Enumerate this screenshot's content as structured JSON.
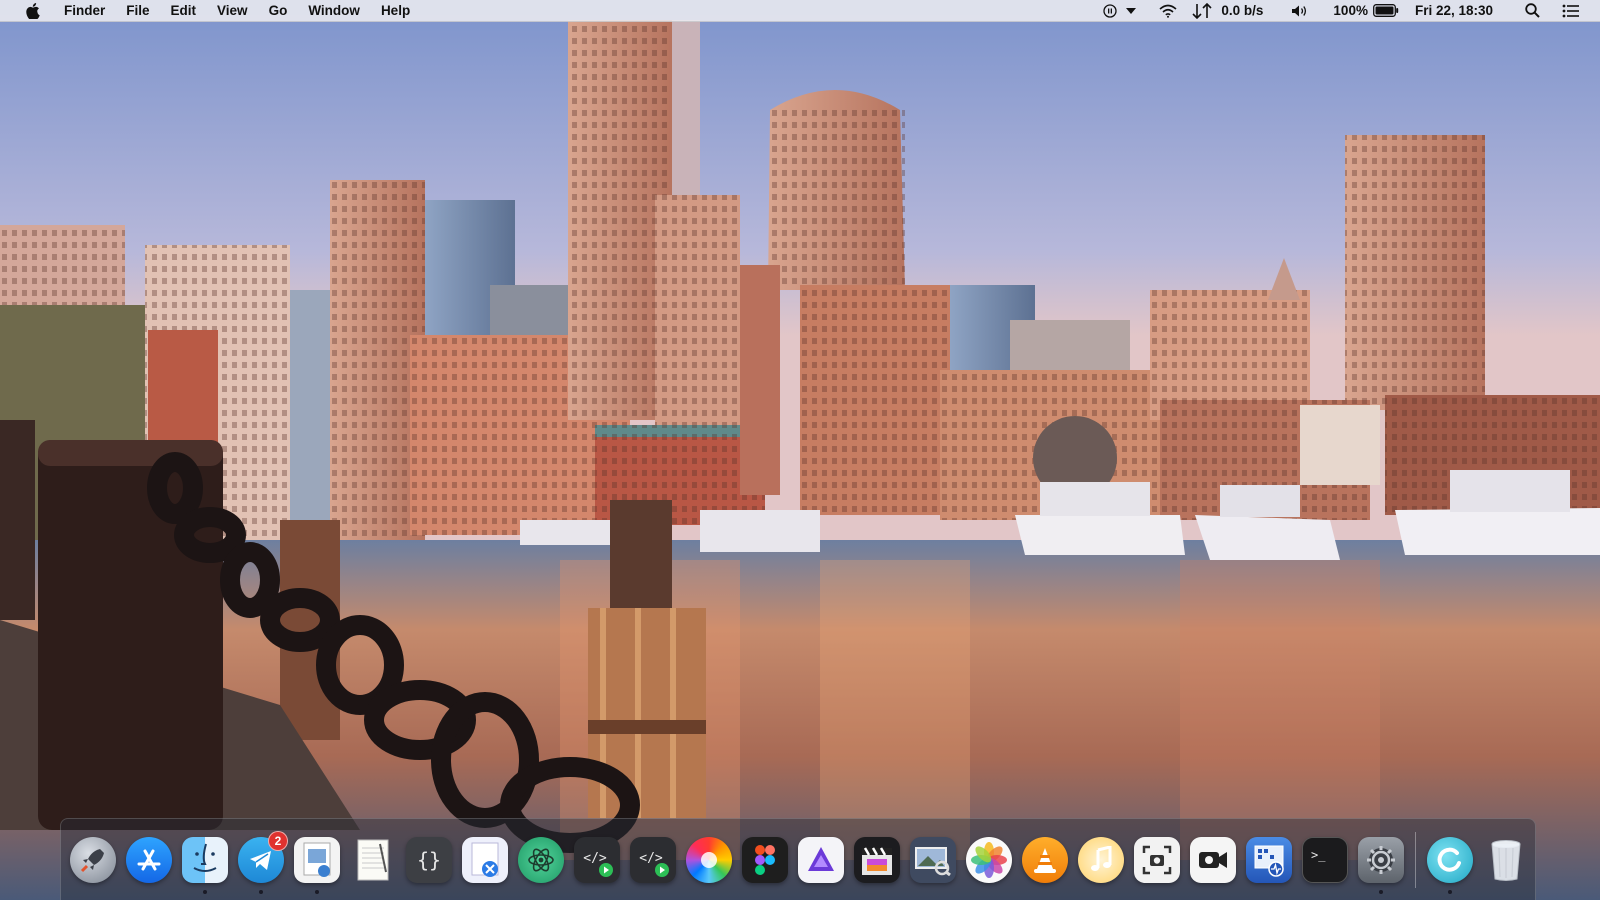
{
  "menubar": {
    "app_name": "Finder",
    "menus": [
      {
        "label": "File"
      },
      {
        "label": "Edit"
      },
      {
        "label": "View"
      },
      {
        "label": "Go"
      },
      {
        "label": "Window"
      },
      {
        "label": "Help"
      }
    ],
    "network_speed": "0.0 b/s",
    "battery_percent": "100%",
    "clock": "Fri 22, 18:30",
    "icons": [
      "apple-icon",
      "media-pause-icon",
      "dropdown-triangle-icon",
      "wifi-icon",
      "network-arrows-icon",
      "volume-icon",
      "battery-icon",
      "spotlight-search-icon",
      "notification-center-icon"
    ]
  },
  "dock": {
    "telegram_badge": "2",
    "apps": [
      {
        "name": "Launchpad",
        "icon": "rocket-icon"
      },
      {
        "name": "App Store",
        "icon": "app-store-icon"
      },
      {
        "name": "Finder",
        "icon": "finder-icon"
      },
      {
        "name": "Telegram",
        "icon": "telegram-icon"
      },
      {
        "name": "Preview",
        "icon": "preview-icon"
      },
      {
        "name": "TextEdit",
        "icon": "textedit-icon"
      },
      {
        "name": "Script Editor",
        "icon": "braces-icon"
      },
      {
        "name": "Xcode",
        "icon": "xcode-icon"
      },
      {
        "name": "Atom",
        "icon": "atom-icon"
      },
      {
        "name": "Code Runner",
        "icon": "code-play-icon"
      },
      {
        "name": "Code Runner 2",
        "icon": "code-play-icon"
      },
      {
        "name": "Color Picker",
        "icon": "color-wheel-icon"
      },
      {
        "name": "Figma",
        "icon": "figma-icon"
      },
      {
        "name": "Affinity",
        "icon": "affinity-icon"
      },
      {
        "name": "Final Cut Pro",
        "icon": "clapperboard-icon"
      },
      {
        "name": "Image Viewer",
        "icon": "image-viewer-icon"
      },
      {
        "name": "Photos",
        "icon": "photos-icon"
      },
      {
        "name": "VLC",
        "icon": "vlc-cone-icon"
      },
      {
        "name": "iTunes",
        "icon": "music-note-icon"
      },
      {
        "name": "Screenshot",
        "icon": "screenshot-icon"
      },
      {
        "name": "Photo Booth",
        "icon": "video-camera-icon"
      },
      {
        "name": "Activity Monitor",
        "icon": "activity-monitor-icon"
      },
      {
        "name": "Terminal",
        "icon": "terminal-icon"
      },
      {
        "name": "System Preferences",
        "icon": "gear-icon"
      },
      {
        "name": "Sync",
        "icon": "sync-icon"
      },
      {
        "name": "Trash",
        "icon": "trash-icon"
      }
    ]
  },
  "colors": {
    "sky_top": "#7f97cf",
    "sky_bottom": "#d8c8d8",
    "water": "#c98a6a",
    "brick": "#c97a5e"
  }
}
